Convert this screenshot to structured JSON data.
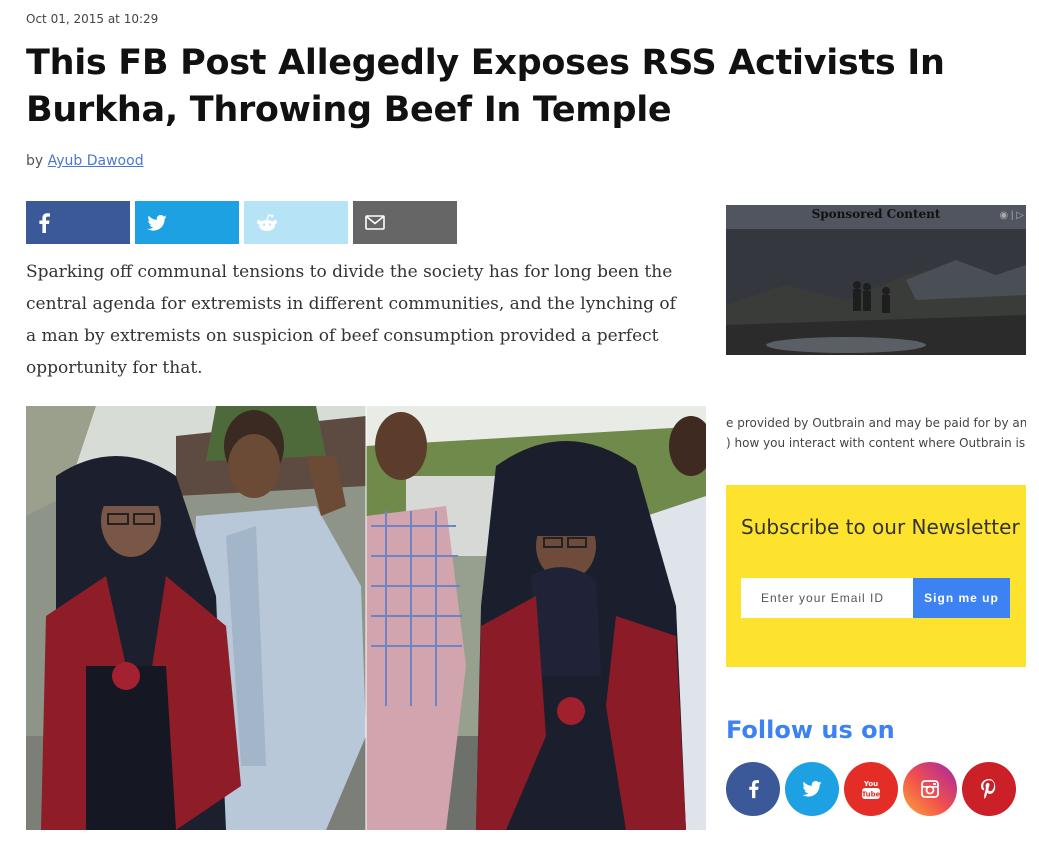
{
  "article": {
    "date": "Oct 01, 2015 at 10:29",
    "title": "This FB Post Allegedly Exposes RSS Activists In Burkha, Throwing Beef In Temple",
    "by_label": "by",
    "author": "Ayub Dawood",
    "intro": "Sparking off communal tensions to divide the society has for long been the central agenda for extremists in different communities, and the lynching of a man by extremists on suspicion of beef consumption provided a perfect opportunity for that."
  },
  "share_buttons": [
    {
      "icon": "facebook-icon",
      "color": "#3b5998"
    },
    {
      "icon": "twitter-icon",
      "color": "#1da1e2"
    },
    {
      "icon": "reddit-icon",
      "color": "#b7e3f7"
    },
    {
      "icon": "email-icon",
      "color": "#666666"
    }
  ],
  "sidebar": {
    "sponsored_label": "Sponsored Content",
    "outbrain_line1": "e provided by Outbrain and may be paid for by an a",
    "outbrain_line2": ") how you interact with content where Outbrain is in",
    "newsletter": {
      "title": "Subscribe to our Newsletter",
      "email_placeholder": "Enter your Email ID",
      "submit_label": "Sign me up",
      "background": "#fde22e",
      "button_color": "#3d82f2"
    },
    "follow_title": "Follow us on",
    "social": [
      {
        "icon": "facebook-icon",
        "color": "#3b5998"
      },
      {
        "icon": "twitter-icon",
        "color": "#1da1e2"
      },
      {
        "icon": "youtube-icon",
        "color": "#e52d27"
      },
      {
        "icon": "instagram-icon",
        "color": "#f3514b"
      },
      {
        "icon": "pinterest-icon",
        "color": "#cb2027"
      }
    ]
  }
}
